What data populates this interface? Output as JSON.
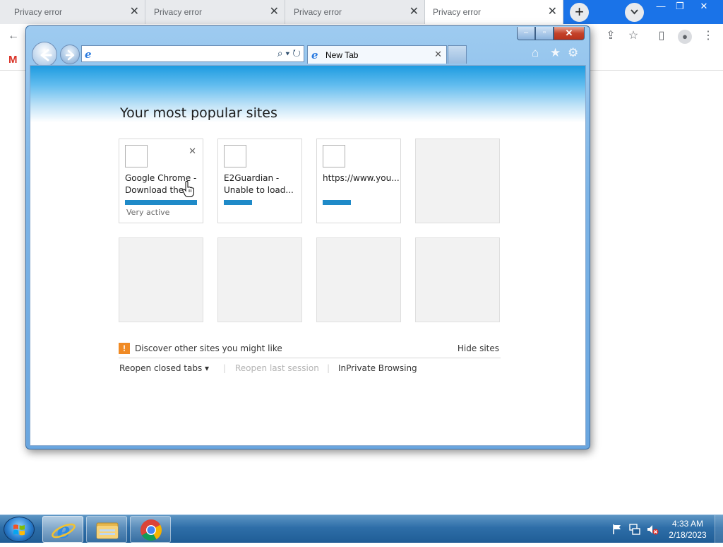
{
  "chrome": {
    "tabs": [
      {
        "label": "Privacy error"
      },
      {
        "label": "Privacy error"
      },
      {
        "label": "Privacy error"
      },
      {
        "label": "Privacy error"
      }
    ],
    "close_glyph": "✕",
    "new_tab_glyph": "+",
    "window_buttons": {
      "minimize": "—",
      "restore": "❐",
      "close": "✕"
    },
    "toolbar_icons": [
      "back-icon",
      "share-icon",
      "star-icon",
      "side-panel-icon",
      "profile-icon",
      "menu-icon"
    ],
    "bookmark_icon": "M"
  },
  "ie": {
    "caption_buttons": {
      "minimize": "–",
      "restore": "▫",
      "close": "✕"
    },
    "address": {
      "value": "",
      "favicon": "e",
      "tools": "⌕ ▾ ↻"
    },
    "tab": {
      "label": "New Tab",
      "favicon": "e",
      "close": "✕"
    },
    "toolbar_icons": {
      "home": "⌂",
      "favorites": "★",
      "tools": "⚙"
    },
    "newtab_page": {
      "title": "Your most popular sites",
      "tiles": [
        {
          "name": "Google Chrome - Download the...",
          "activity": "Very active",
          "bar": 1.0,
          "empty": false
        },
        {
          "name": "E2Guardian - Unable to load...",
          "activity": "",
          "bar": 0.4,
          "empty": false
        },
        {
          "name": "https://www.you...",
          "activity": "",
          "bar": 0.4,
          "empty": false
        },
        {
          "name": "",
          "empty": true
        },
        {
          "name": "",
          "empty": true
        },
        {
          "name": "",
          "empty": true
        },
        {
          "name": "",
          "empty": true
        },
        {
          "name": "",
          "empty": true
        }
      ],
      "tile_close": "✕",
      "discover_text": "Discover other sites you might like",
      "hide_sites": "Hide sites",
      "reopen_closed_tabs": "Reopen closed tabs ▾",
      "separator": "|",
      "reopen_last_session": "Reopen last session",
      "inprivate": "InPrivate Browsing"
    }
  },
  "taskbar": {
    "pinned": [
      "internet-explorer-icon",
      "file-explorer-icon",
      "chrome-icon"
    ],
    "tray_icons": [
      "action-center-flag-icon",
      "network-icon",
      "volume-muted-icon"
    ],
    "time": "4:33 AM",
    "date": "2/18/2023"
  },
  "colors": {
    "chrome_tabstrip": "#1a73e8",
    "ie_accent": "#1f8ac8",
    "taskbar": "#2e6ea8"
  }
}
